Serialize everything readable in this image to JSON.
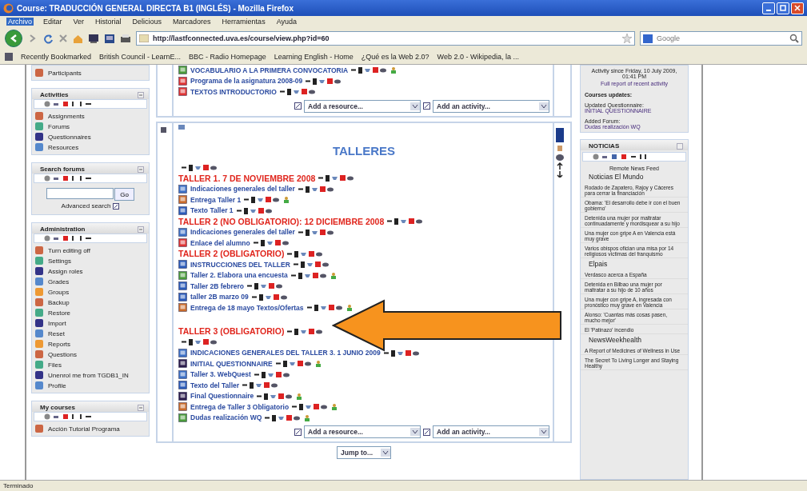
{
  "window": {
    "title": "Course: TRADUCCIÓN GENERAL DIRECTA B1 (INGLÉS) - Mozilla Firefox"
  },
  "menu": [
    {
      "label": "Archivo",
      "selected": true
    },
    {
      "label": "Editar",
      "selected": false
    },
    {
      "label": "Ver",
      "selected": false
    },
    {
      "label": "Historial",
      "selected": false
    },
    {
      "label": "Delicious",
      "selected": false
    },
    {
      "label": "Marcadores",
      "selected": false
    },
    {
      "label": "Herramientas",
      "selected": false
    },
    {
      "label": "Ayuda",
      "selected": false
    }
  ],
  "address": {
    "value": "http://lastfconnected.uva.es/course/view.php?id=60"
  },
  "search": {
    "placeholder": "Google"
  },
  "bookmarks": [
    "Recently Bookmarked",
    "British Council - LearnE...",
    "BBC - Radio Homepage",
    "Learning English - Home",
    "¿Qué es la Web 2.0?",
    "Web 2.0 - Wikipedia, la ..."
  ],
  "left_blocks": [
    {
      "items": [
        "Participants"
      ]
    },
    {
      "title": "Activities",
      "items": [
        "Assignments",
        "Forums",
        "Questionnaires",
        "Resources"
      ]
    },
    {
      "title": "Search forums",
      "kind": "search",
      "button": "Go",
      "link": "Advanced search"
    },
    {
      "title": "Administration",
      "items": [
        "Turn editing off",
        "Settings",
        "Assign roles",
        "Grades",
        "Groups",
        "Backup",
        "Restore",
        "Import",
        "Reset",
        "Reports",
        "Questions",
        "Files",
        "Unenrol me from TGDB1_IN",
        "Profile"
      ]
    },
    {
      "title": "My courses",
      "items": [
        "Acción Tutorial Programa"
      ]
    }
  ],
  "sections": [
    {
      "items": [
        {
          "kind": "forum",
          "text": "VOCABULARIO A LA PRIMERA CONVOCATORIA",
          "group": true
        },
        {
          "kind": "pdf",
          "text": "Programa de la asignatura 2008-09",
          "group": false
        },
        {
          "kind": "pdf",
          "text": "TEXTOS INTRODUCTORIO",
          "group": false
        }
      ],
      "add_resource": "Add a resource...",
      "add_activity": "Add an activity..."
    },
    {
      "title": "TALLERES",
      "items": [
        {
          "kind": "controls"
        },
        {
          "kind": "heading",
          "text": "TALLER 1. 7 DE NOVIEMBRE 2008"
        },
        {
          "kind": "page",
          "text": "Indicaciones generales del taller",
          "group": false
        },
        {
          "kind": "assignment",
          "text": "Entrega Taller 1",
          "group": true
        },
        {
          "kind": "document",
          "text": "Texto Taller 1",
          "group": false
        },
        {
          "kind": "heading",
          "text": "TALLER 2 (NO OBLIGATORIO): 12 DICIEMBRE 2008"
        },
        {
          "kind": "page",
          "text": "Indicaciones generales del taller",
          "group": false
        },
        {
          "kind": "pdf",
          "text": "Enlace del alumno",
          "group": false
        },
        {
          "kind": "heading",
          "text": "TALLER 2 (OBLIGATORIO)"
        },
        {
          "kind": "document",
          "text": "INSTRUCCIONES DEL TALLER",
          "group": false
        },
        {
          "kind": "forum",
          "text": "Taller 2. Elabora una encuesta",
          "group": true
        },
        {
          "kind": "document",
          "text": "Taller 2B febrero",
          "group": false
        },
        {
          "kind": "document",
          "text": "taller 2B marzo 09",
          "group": false
        },
        {
          "kind": "assignment",
          "text": "Entrega de 18 mayo Textos/Ofertas",
          "group": true
        },
        {
          "kind": "heading",
          "text": "TALLER 3 (OBLIGATORIO)"
        },
        {
          "kind": "controls"
        },
        {
          "kind": "page",
          "text": "INDICACIONES GENERALES DEL TALLER 3. 1 JUNIO 2009",
          "group": false
        },
        {
          "kind": "questionnaire",
          "text": "INITIAL QUESTIONNAIRE",
          "group": true
        },
        {
          "kind": "page",
          "text": "Taller 3. WebQuest",
          "group": false
        },
        {
          "kind": "document",
          "text": "Texto del Taller",
          "group": false
        },
        {
          "kind": "questionnaire",
          "text": "Final Questionnaire",
          "group": true
        },
        {
          "kind": "assignment",
          "text": "Entrega de Taller 3 Obligatorio",
          "group": true
        },
        {
          "kind": "forum",
          "text": "Dudas realización WQ",
          "group": true
        }
      ],
      "add_resource": "Add a resource...",
      "add_activity": "Add an activity..."
    }
  ],
  "jump": {
    "value": "Jump to..."
  },
  "recent": {
    "since": "Activity since Friday, 10 July 2009, 01:41 PM",
    "report": "Full report of recent activity",
    "heading": "Courses updates:",
    "updates": [
      {
        "label": "Updated Questionnaire:",
        "link": "INITIAL QUESTIONNAIRE"
      },
      {
        "label": "Added Forum:",
        "link": "Dudas realización WQ"
      }
    ]
  },
  "news": {
    "title": "NOTICIAS",
    "feed_label": "Remote News Feed",
    "feeds": [
      {
        "name": "Noticias El Mundo",
        "items": [
          "Rodado de Zapatero, Rajoy y Cáceres para cerrar la financiación",
          "Obama: 'El desarrollo debe ir con el buen gobierno'",
          "Detenida una mujer por maltratar continuadamente y mordisquear a su hijo",
          "Una mujer con gripe A en Valencia está muy grave",
          "Varios obispos ofician una misa por 14 religiosos víctimas del franquismo"
        ]
      },
      {
        "name": "Elpais",
        "items": [
          "Verdasco acerca a España",
          "Detenida en Bilbao una mujer por maltratar a su hijo de 10 años",
          "Una mujer con gripe A, ingresada con pronóstico muy grave en Valencia",
          "Alonso: 'Cuantas más cosas pasen, mucho mejor'",
          "El 'Patinazo' incendio"
        ]
      },
      {
        "name": "NewsWeekhealth",
        "items": [
          "A Report of Medicines of Wellness in Use",
          "The Secret To Living Longer and Staying Healthy"
        ]
      }
    ]
  },
  "status_bar": {
    "text": "Terminado"
  }
}
